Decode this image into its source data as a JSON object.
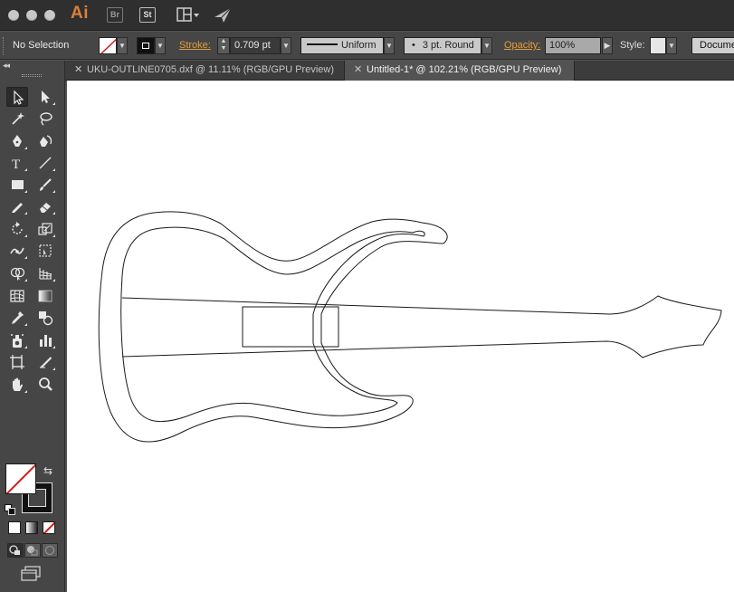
{
  "app": {
    "logo": "Ai",
    "bridge_label": "Br",
    "stock_label": "St"
  },
  "control_bar": {
    "selection_label": "No Selection",
    "stroke_label": "Stroke:",
    "stroke_value": "0.709 pt",
    "profile_value": "Uniform",
    "brush_value": "3 pt. Round",
    "opacity_label": "Opacity:",
    "opacity_value": "100%",
    "style_label": "Style:",
    "document_button": "Docume"
  },
  "tabs": [
    {
      "label": "UKU-OUTLINE0705.dxf @ 11.11% (RGB/GPU Preview)",
      "close": "✕",
      "active": false
    },
    {
      "label": "Untitled-1* @ 102.21% (RGB/GPU Preview)",
      "close": "✕",
      "active": true
    }
  ],
  "toolbar": {
    "collapse_glyph": "◂◂",
    "tools": [
      "selection-tool",
      "direct-selection-tool",
      "magic-wand-tool",
      "lasso-tool",
      "pen-tool",
      "curvature-tool",
      "type-tool",
      "line-segment-tool",
      "rectangle-tool",
      "paintbrush-tool",
      "pencil-tool",
      "eraser-tool",
      "rotate-tool",
      "scale-tool",
      "width-tool",
      "free-transform-tool",
      "shape-builder-tool",
      "perspective-grid-tool",
      "mesh-tool",
      "gradient-tool",
      "eyedropper-tool",
      "blend-tool",
      "symbol-sprayer-tool",
      "column-graph-tool",
      "artboard-tool",
      "slice-tool",
      "hand-tool",
      "zoom-tool"
    ],
    "fill": "none",
    "stroke_color": "#111111"
  },
  "colors": {
    "accent": "#e79b3a",
    "logo": "#d9813a",
    "none_red": "#d11a1a",
    "artboard": "#ffffff",
    "stroke": "#1a1a1a"
  },
  "artwork": {
    "description_shape": "guitar-outline"
  }
}
